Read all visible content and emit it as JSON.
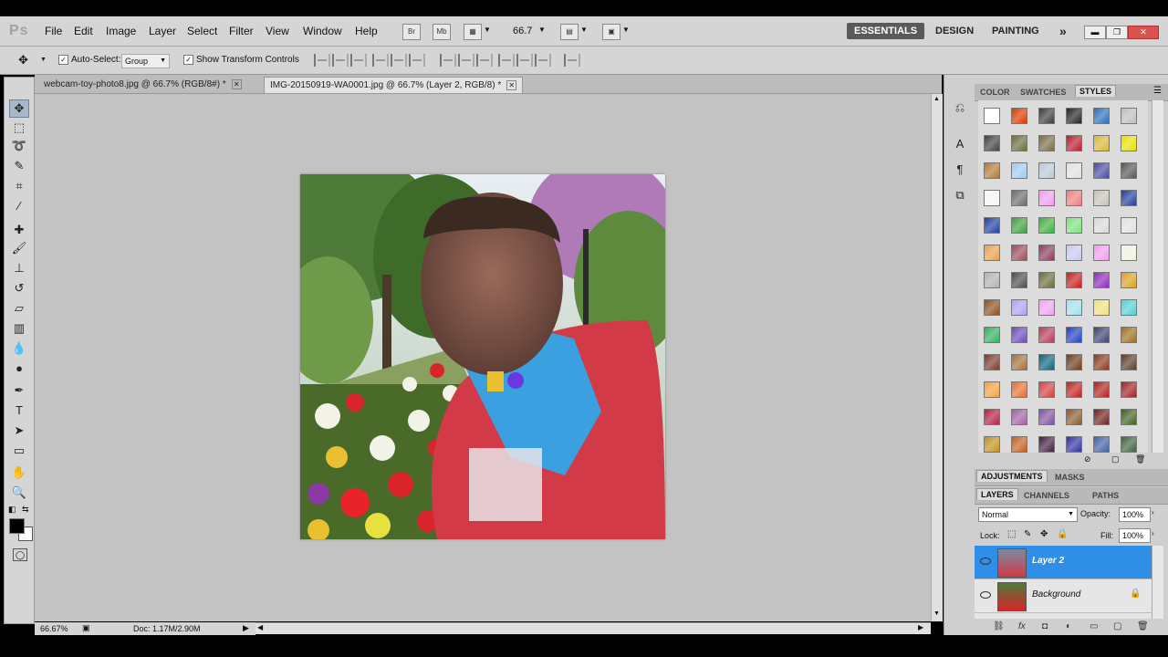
{
  "app": {
    "logo": "Ps"
  },
  "menu": [
    "File",
    "Edit",
    "Image",
    "Layer",
    "Select",
    "Filter",
    "View",
    "Window",
    "Help"
  ],
  "appbar": {
    "bridge": "Br",
    "minibridge": "Mb",
    "zoom": "66.7"
  },
  "workspaces": {
    "essentials": "ESSENTIALS",
    "design": "DESIGN",
    "painting": "PAINTING",
    "more": "»"
  },
  "options": {
    "auto_select_label": "Auto-Select:",
    "auto_select_value": "Group",
    "transform_label": "Show Transform Controls"
  },
  "tabs": [
    {
      "label": "webcam-toy-photo8.jpg @ 66.7% (RGB/8#) *"
    },
    {
      "label": "IMG-20150919-WA0001.jpg @ 66.7% (Layer 2, RGB/8) *"
    }
  ],
  "status": {
    "zoom": "66.67%",
    "doc": "Doc: 1.17M/2.90M"
  },
  "panels": {
    "top_tabs": [
      "COLOR",
      "SWATCHES",
      "STYLES"
    ],
    "adj_tabs": [
      "ADJUSTMENTS",
      "MASKS"
    ],
    "layer_tabs": [
      "LAYERS",
      "CHANNELS",
      "PATHS"
    ],
    "blend_mode": "Normal",
    "opacity_label": "Opacity:",
    "opacity_value": "100%",
    "lock_label": "Lock:",
    "fill_label": "Fill:",
    "fill_value": "100%",
    "layers": [
      {
        "name": "Layer 2"
      },
      {
        "name": "Background"
      }
    ]
  },
  "colors": {
    "accent": "#2f8fe6",
    "foreground": "#000000",
    "background": "#ffffff"
  },
  "style_swatches": [
    "#ffffff",
    "#d63a00",
    "#3c3c3c",
    "#222222",
    "#2a6fb6",
    "#bdbdbd",
    "#404040",
    "#6b6b3a",
    "#7a6a45",
    "#b81c2c",
    "#d4b83a",
    "#e8e000",
    "#b07a3a",
    "#9ec9ef",
    "#b9c7d6",
    "#e0e0e0",
    "#4a4a9e",
    "#555555",
    "#f5f5f5",
    "#6a6a6a",
    "#f09cf0",
    "#f07a7a",
    "#c7c0b8",
    "#1f3f9e",
    "#1f3f9e",
    "#3f9e3f",
    "#3fae3f",
    "#7fe07f",
    "#d8d8d8",
    "#e0e0e0",
    "#e8a050",
    "#9a4a5a",
    "#8a3a5a",
    "#c8c8f0",
    "#f09cf0",
    "#f0f0e0",
    "#b0b0b0",
    "#4a4a4a",
    "#6a6a3a",
    "#c81c1c",
    "#8a2ab6",
    "#d8a020",
    "#8a5020",
    "#b0a0f0",
    "#f0a0f0",
    "#a0e0f0",
    "#f0e080",
    "#50d0d0",
    "#30b060",
    "#6a4ab6",
    "#b83a5a",
    "#2040c0",
    "#404070",
    "#9a7020",
    "#7a3a2a",
    "#a07040",
    "#106080",
    "#6a3a1a",
    "#8a3a1a",
    "#5a3a2a",
    "#f0a040",
    "#e07030",
    "#d04040",
    "#c02020",
    "#b02020",
    "#a02020",
    "#b02040",
    "#a060a0",
    "#8050a0",
    "#8a5a2a",
    "#702020",
    "#406020",
    "#c09020",
    "#c06020",
    "#402040",
    "#3030a0",
    "#4060a0",
    "#406040"
  ]
}
